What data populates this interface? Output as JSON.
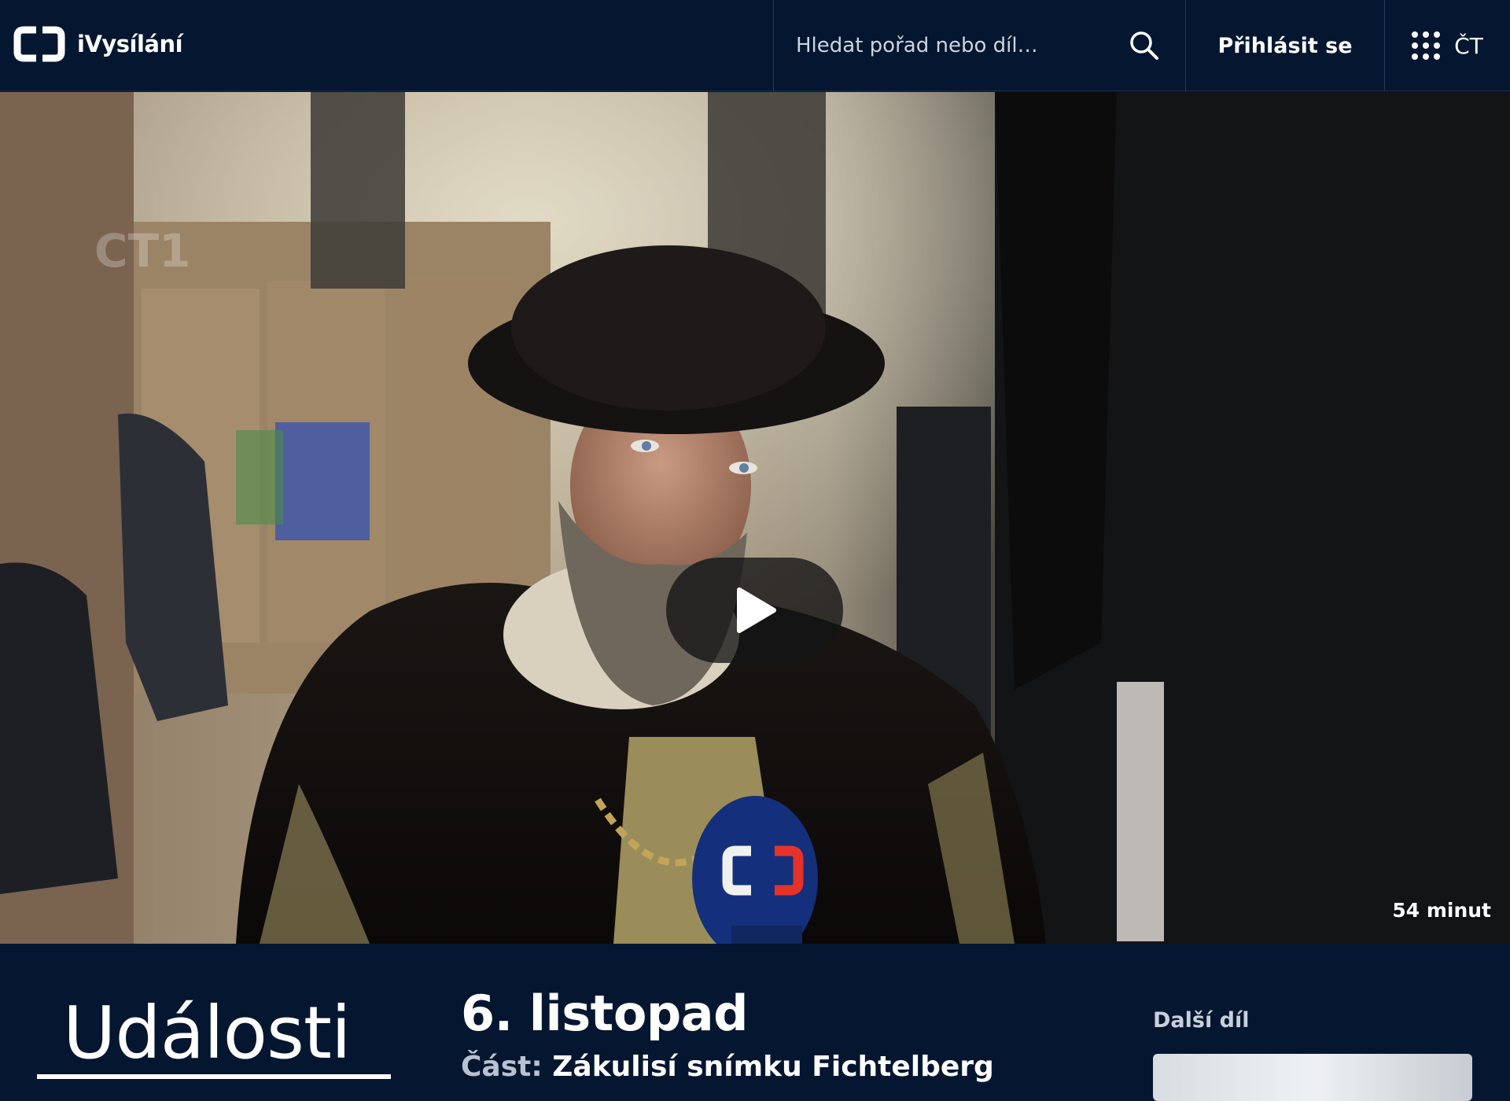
{
  "header": {
    "brand_name": "iVysílání",
    "search_placeholder": "Hledat pořad nebo díl…",
    "login_label": "Přihlásit se",
    "apps_label": "ČT"
  },
  "video": {
    "duration": "54 minut"
  },
  "info": {
    "show_title": "Události",
    "episode_title": "6. listopad",
    "part_key": "Část:",
    "part_value": "Zákulisí snímku Fichtelberg",
    "next_label": "Další díl"
  },
  "colors": {
    "background": "#041630",
    "text": "#ffffff",
    "muted_text": "#b9c2d0"
  },
  "icons": [
    "ct-logo-icon",
    "search-icon",
    "apps-grid-icon",
    "play-icon"
  ]
}
